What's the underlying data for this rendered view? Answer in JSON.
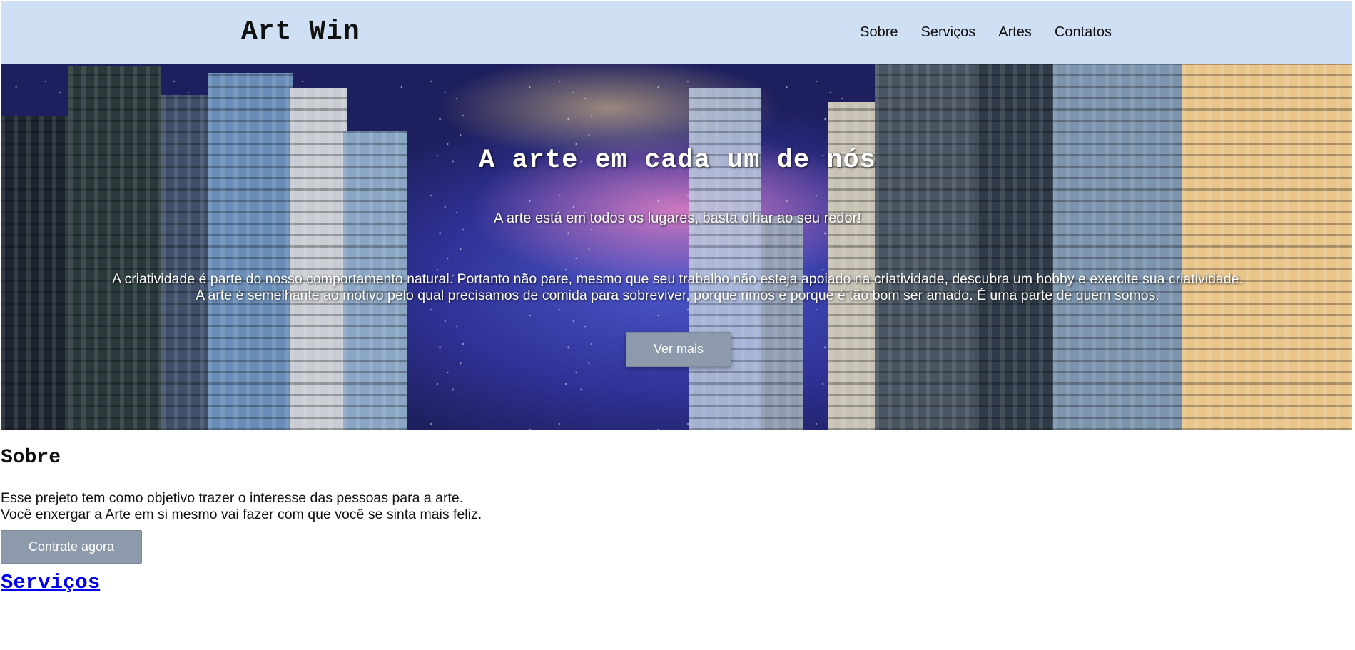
{
  "header": {
    "brand": "Art Win",
    "nav": [
      "Sobre",
      "Serviços",
      "Artes",
      "Contatos"
    ]
  },
  "hero": {
    "title": "A arte em cada um de nós",
    "subtitle": "A arte está em todos os lugares, basta olhar ao seu redor!",
    "body_lines": [
      "A criatividade é parte do nosso comportamento natural. Portanto não pare, mesmo que seu trabalho não esteja apoiado na criatividade, descubra um hobby e exercite sua criatividade.",
      "A arte é semelhante ao motivo pelo qual precisamos de comida para sobreviver, porque rimos e porque é tão bom ser amado. É uma parte de quem somos."
    ],
    "button_label": "Ver mais"
  },
  "about": {
    "title": "Sobre",
    "lines": [
      "Esse prejeto tem como objetivo trazer o interesse das pessoas para a arte.",
      "Você enxergar a Arte em si mesmo vai fazer com que você se sinta mais feliz."
    ],
    "button_label": "Contrate agora"
  },
  "services": {
    "link_label": "Serviços"
  },
  "colors": {
    "header_bg": "#cfe0f5",
    "button_bg": "#8d9aab",
    "link": "#0000ee"
  }
}
